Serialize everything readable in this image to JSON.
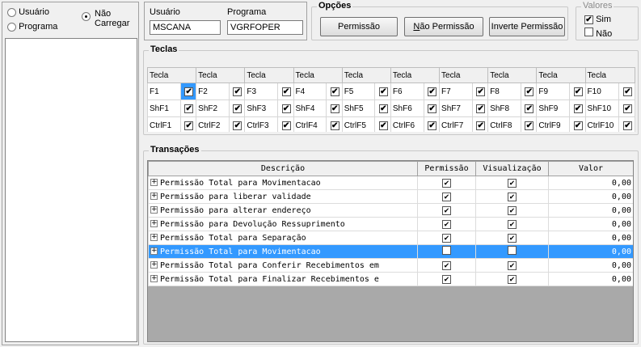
{
  "mode": {
    "opt_usuario": "Usuário",
    "opt_programa": "Programa",
    "opt_nao_carregar_1": "Não",
    "opt_nao_carregar_2": "Carregar"
  },
  "inputs": {
    "usuario_label": "Usuário",
    "usuario_value": "MSCANA",
    "programa_label": "Programa",
    "programa_value": "VGRFOPER"
  },
  "opcoes": {
    "title": "Opções",
    "btn_permissao": "Permissão",
    "btn_nao_permissao_u": "N",
    "btn_nao_permissao_rest": "ão Permissão",
    "btn_inverte": "Inverte Permissão"
  },
  "valores": {
    "title": "Valores",
    "sim": "Sim",
    "nao": "Não"
  },
  "teclas": {
    "title": "Teclas",
    "header": "Tecla",
    "rows": [
      [
        "F1",
        "F2",
        "F3",
        "F4",
        "F5",
        "F6",
        "F7",
        "F8",
        "F9",
        "F10"
      ],
      [
        "ShF1",
        "ShF2",
        "ShF3",
        "ShF4",
        "ShF5",
        "ShF6",
        "ShF7",
        "ShF8",
        "ShF9",
        "ShF10"
      ],
      [
        "CtrlF1",
        "CtrlF2",
        "CtrlF3",
        "CtrlF4",
        "CtrlF5",
        "CtrlF6",
        "CtrlF7",
        "CtrlF8",
        "CtrlF9",
        "CtrlF10"
      ]
    ]
  },
  "transacoes": {
    "title": "Transações",
    "columns": [
      "Descrição",
      "Permissão",
      "Visualização",
      "Valor"
    ],
    "rows": [
      {
        "desc": "Permissão Total para Movimentacao",
        "perm": true,
        "vis": true,
        "valor": "0,00"
      },
      {
        "desc": "Permissão para liberar validade",
        "perm": true,
        "vis": true,
        "valor": "0,00"
      },
      {
        "desc": "Permissão para alterar endereço",
        "perm": true,
        "vis": true,
        "valor": "0,00"
      },
      {
        "desc": "Permissão para Devolução Ressuprimento",
        "perm": true,
        "vis": true,
        "valor": "0,00"
      },
      {
        "desc": "Permissão Total para Separação",
        "perm": true,
        "vis": true,
        "valor": "0,00"
      },
      {
        "desc": "Permissão Total para Movimentacao",
        "perm": false,
        "vis": false,
        "valor": "0,00",
        "selected": true
      },
      {
        "desc": "Permissão Total para Conferir Recebimentos em",
        "perm": true,
        "vis": true,
        "valor": "0,00"
      },
      {
        "desc": "Permissão Total para Finalizar Recebimentos e",
        "perm": true,
        "vis": true,
        "valor": "0,00"
      }
    ]
  },
  "colors": {
    "selection": "#3399ff",
    "empty_area": "#a9a9a9"
  },
  "check_glyph": "✔"
}
